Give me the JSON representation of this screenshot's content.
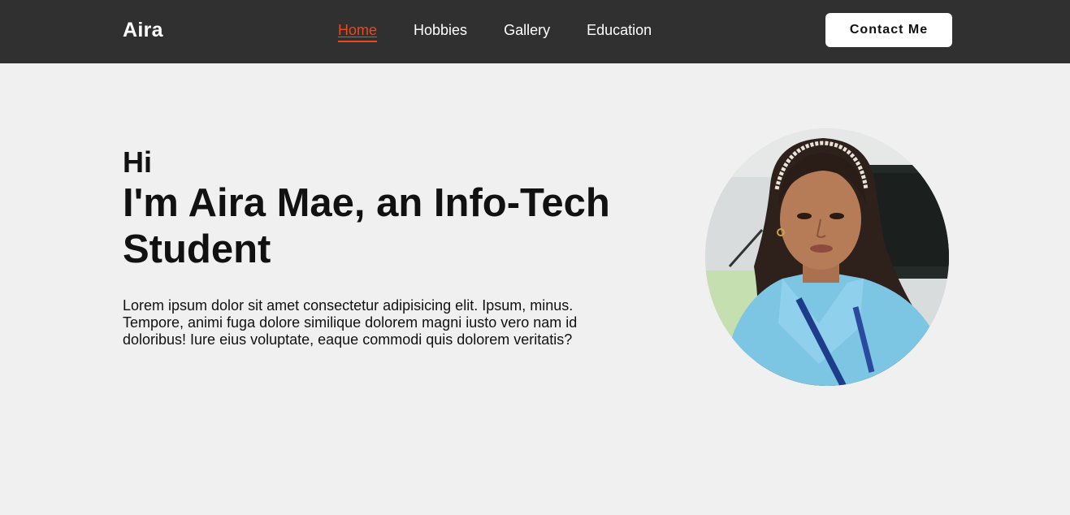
{
  "nav": {
    "brand": "Aira",
    "links": [
      {
        "label": "Home",
        "active": true
      },
      {
        "label": "Hobbies",
        "active": false
      },
      {
        "label": "Gallery",
        "active": false
      },
      {
        "label": "Education",
        "active": false
      }
    ],
    "contact_label": "Contact Me"
  },
  "hero": {
    "greeting": "Hi",
    "headline": "I'm Aira Mae, an Info-Tech Student",
    "intro": "Lorem ipsum dolor sit amet consectetur adipisicing elit. Ipsum, minus. Tempore, animi fuga dolore similique dolorem magni iusto vero nam id doloribus! Iure eius voluptate, eaque commodi quis dolorem veritatis?"
  },
  "colors": {
    "navbar_bg": "#303030",
    "accent": "#e8491d",
    "page_bg": "#f0f0f0"
  }
}
